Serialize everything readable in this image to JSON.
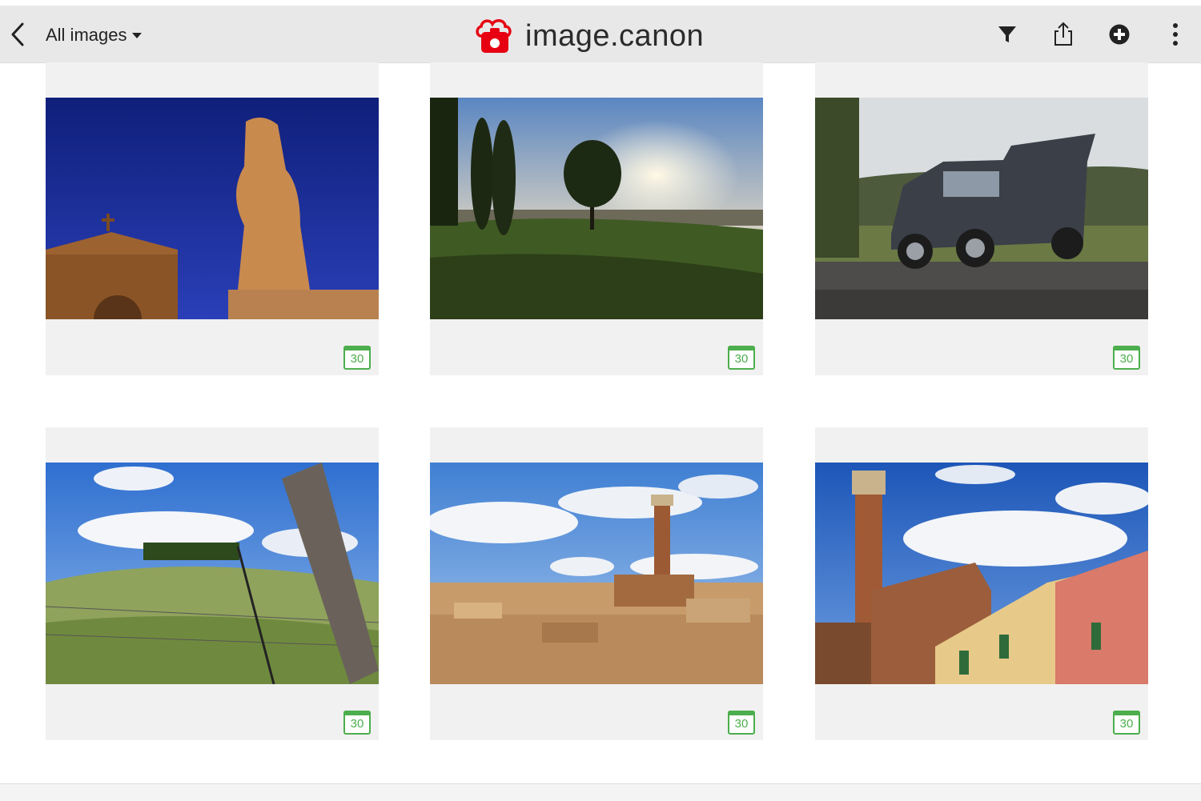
{
  "header": {
    "back_icon": "chevron-left-icon",
    "filter_label": "All images",
    "brand_name": "image.canon",
    "brand_color": "#e60012",
    "actions": [
      "filter-icon",
      "share-icon",
      "add-icon",
      "more-vertical-icon"
    ]
  },
  "badge_color": "#4cae4c",
  "gallery": {
    "items": [
      {
        "subject": "Statue against deep blue sky with church",
        "badge": "30"
      },
      {
        "subject": "Cypress trees and sunset over Tuscan hills",
        "badge": "30"
      },
      {
        "subject": "SUV with open tailgate on gravel road",
        "badge": "30"
      },
      {
        "subject": "Fence post and vineyard hill with cypresses",
        "badge": "30"
      },
      {
        "subject": "Siena cityscape with tower",
        "badge": "30"
      },
      {
        "subject": "Torre del Mangia and colorful buildings",
        "badge": "30"
      }
    ]
  }
}
